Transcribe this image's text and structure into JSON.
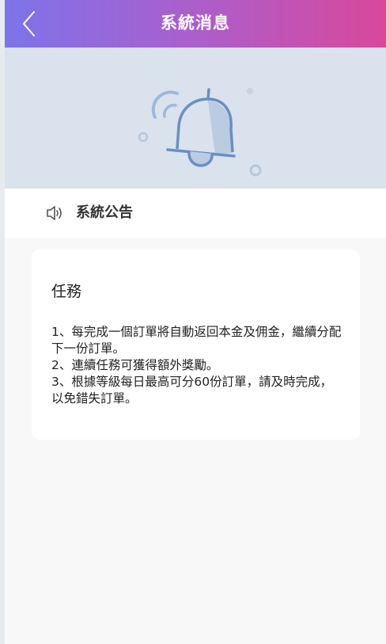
{
  "header": {
    "title": "系統消息",
    "back_icon": "chevron-left-icon"
  },
  "banner": {
    "icon": "bell-icon"
  },
  "notice": {
    "icon": "speaker-icon",
    "title": "系統公告"
  },
  "message": {
    "title": "任務",
    "lines": [
      " 1、每完成一個訂單將自動返回本金及佣金，繼續分配下一份訂單。",
      " 2、連續任務可獲得額外獎勵。",
      " 3、根據等級每日最高可分60份訂單，請及時完成，以免錯失訂單。"
    ]
  },
  "colors": {
    "header_gradient_start": "#7d73ea",
    "header_gradient_end": "#d9489a",
    "banner_bg": "#d9e2ed",
    "bell_stroke": "#6b8fbf"
  }
}
